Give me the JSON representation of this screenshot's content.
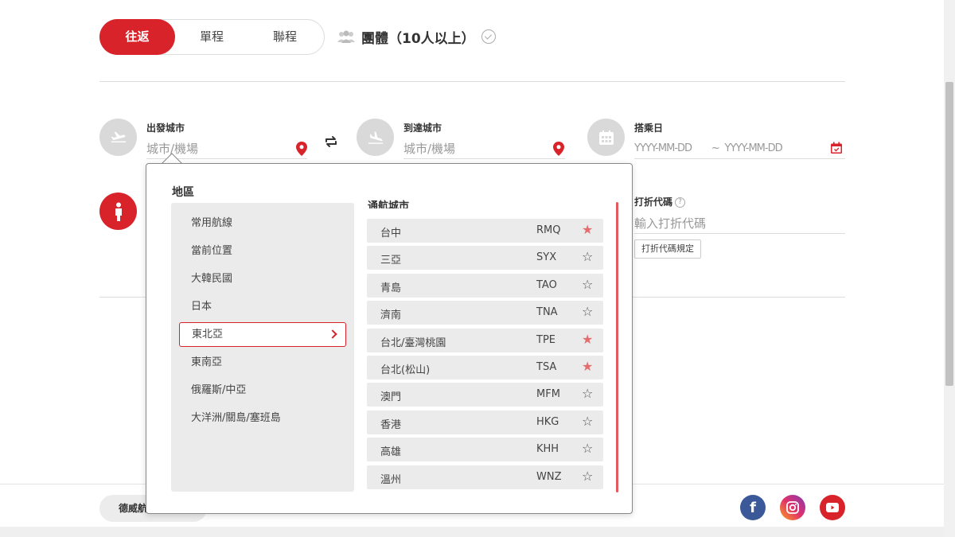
{
  "trip_types": {
    "round_trip": "往返",
    "one_way": "單程",
    "multi_city": "聯程",
    "group": "團體（10人以上）"
  },
  "origin": {
    "label": "出發城市",
    "placeholder": "城市/機場"
  },
  "destination": {
    "label": "到達城市",
    "placeholder": "城市/機場"
  },
  "travel_date": {
    "label": "搭乘日",
    "start": "YYYY-MM-DD",
    "separator": "~",
    "end": "YYYY-MM-DD"
  },
  "discount": {
    "label": "打折代碼",
    "placeholder": "輸入打折代碼",
    "rules_button": "打折代碼規定"
  },
  "dropdown": {
    "region_title": "地區",
    "regions": [
      "常用航線",
      "當前位置",
      "大韓民國",
      "日本",
      "東北亞",
      "東南亞",
      "俄羅斯/中亞",
      "大洋洲/關島/塞班島"
    ],
    "selected_region": "東北亞",
    "city_title": "通航城市",
    "cities": [
      {
        "name": "台中",
        "code": "RMQ",
        "favorite": true
      },
      {
        "name": "三亞",
        "code": "SYX",
        "favorite": false
      },
      {
        "name": "青島",
        "code": "TAO",
        "favorite": false
      },
      {
        "name": "濟南",
        "code": "TNA",
        "favorite": false
      },
      {
        "name": "台北/臺灣桃園",
        "code": "TPE",
        "favorite": true
      },
      {
        "name": "台北(松山)",
        "code": "TSA",
        "favorite": true
      },
      {
        "name": "澳門",
        "code": "MFM",
        "favorite": false
      },
      {
        "name": "香港",
        "code": "HKG",
        "favorite": false
      },
      {
        "name": "高雄",
        "code": "KHH",
        "favorite": false
      },
      {
        "name": "溫州",
        "code": "WNZ",
        "favorite": false
      }
    ]
  },
  "footer": {
    "pill_label": "德威航空",
    "social": [
      "facebook-icon",
      "instagram-icon",
      "youtube-icon"
    ]
  },
  "colors": {
    "brand_red": "#d8232a",
    "star_on": "#e46c6c",
    "facebook": "#3b5998",
    "youtube": "#d8232a"
  }
}
